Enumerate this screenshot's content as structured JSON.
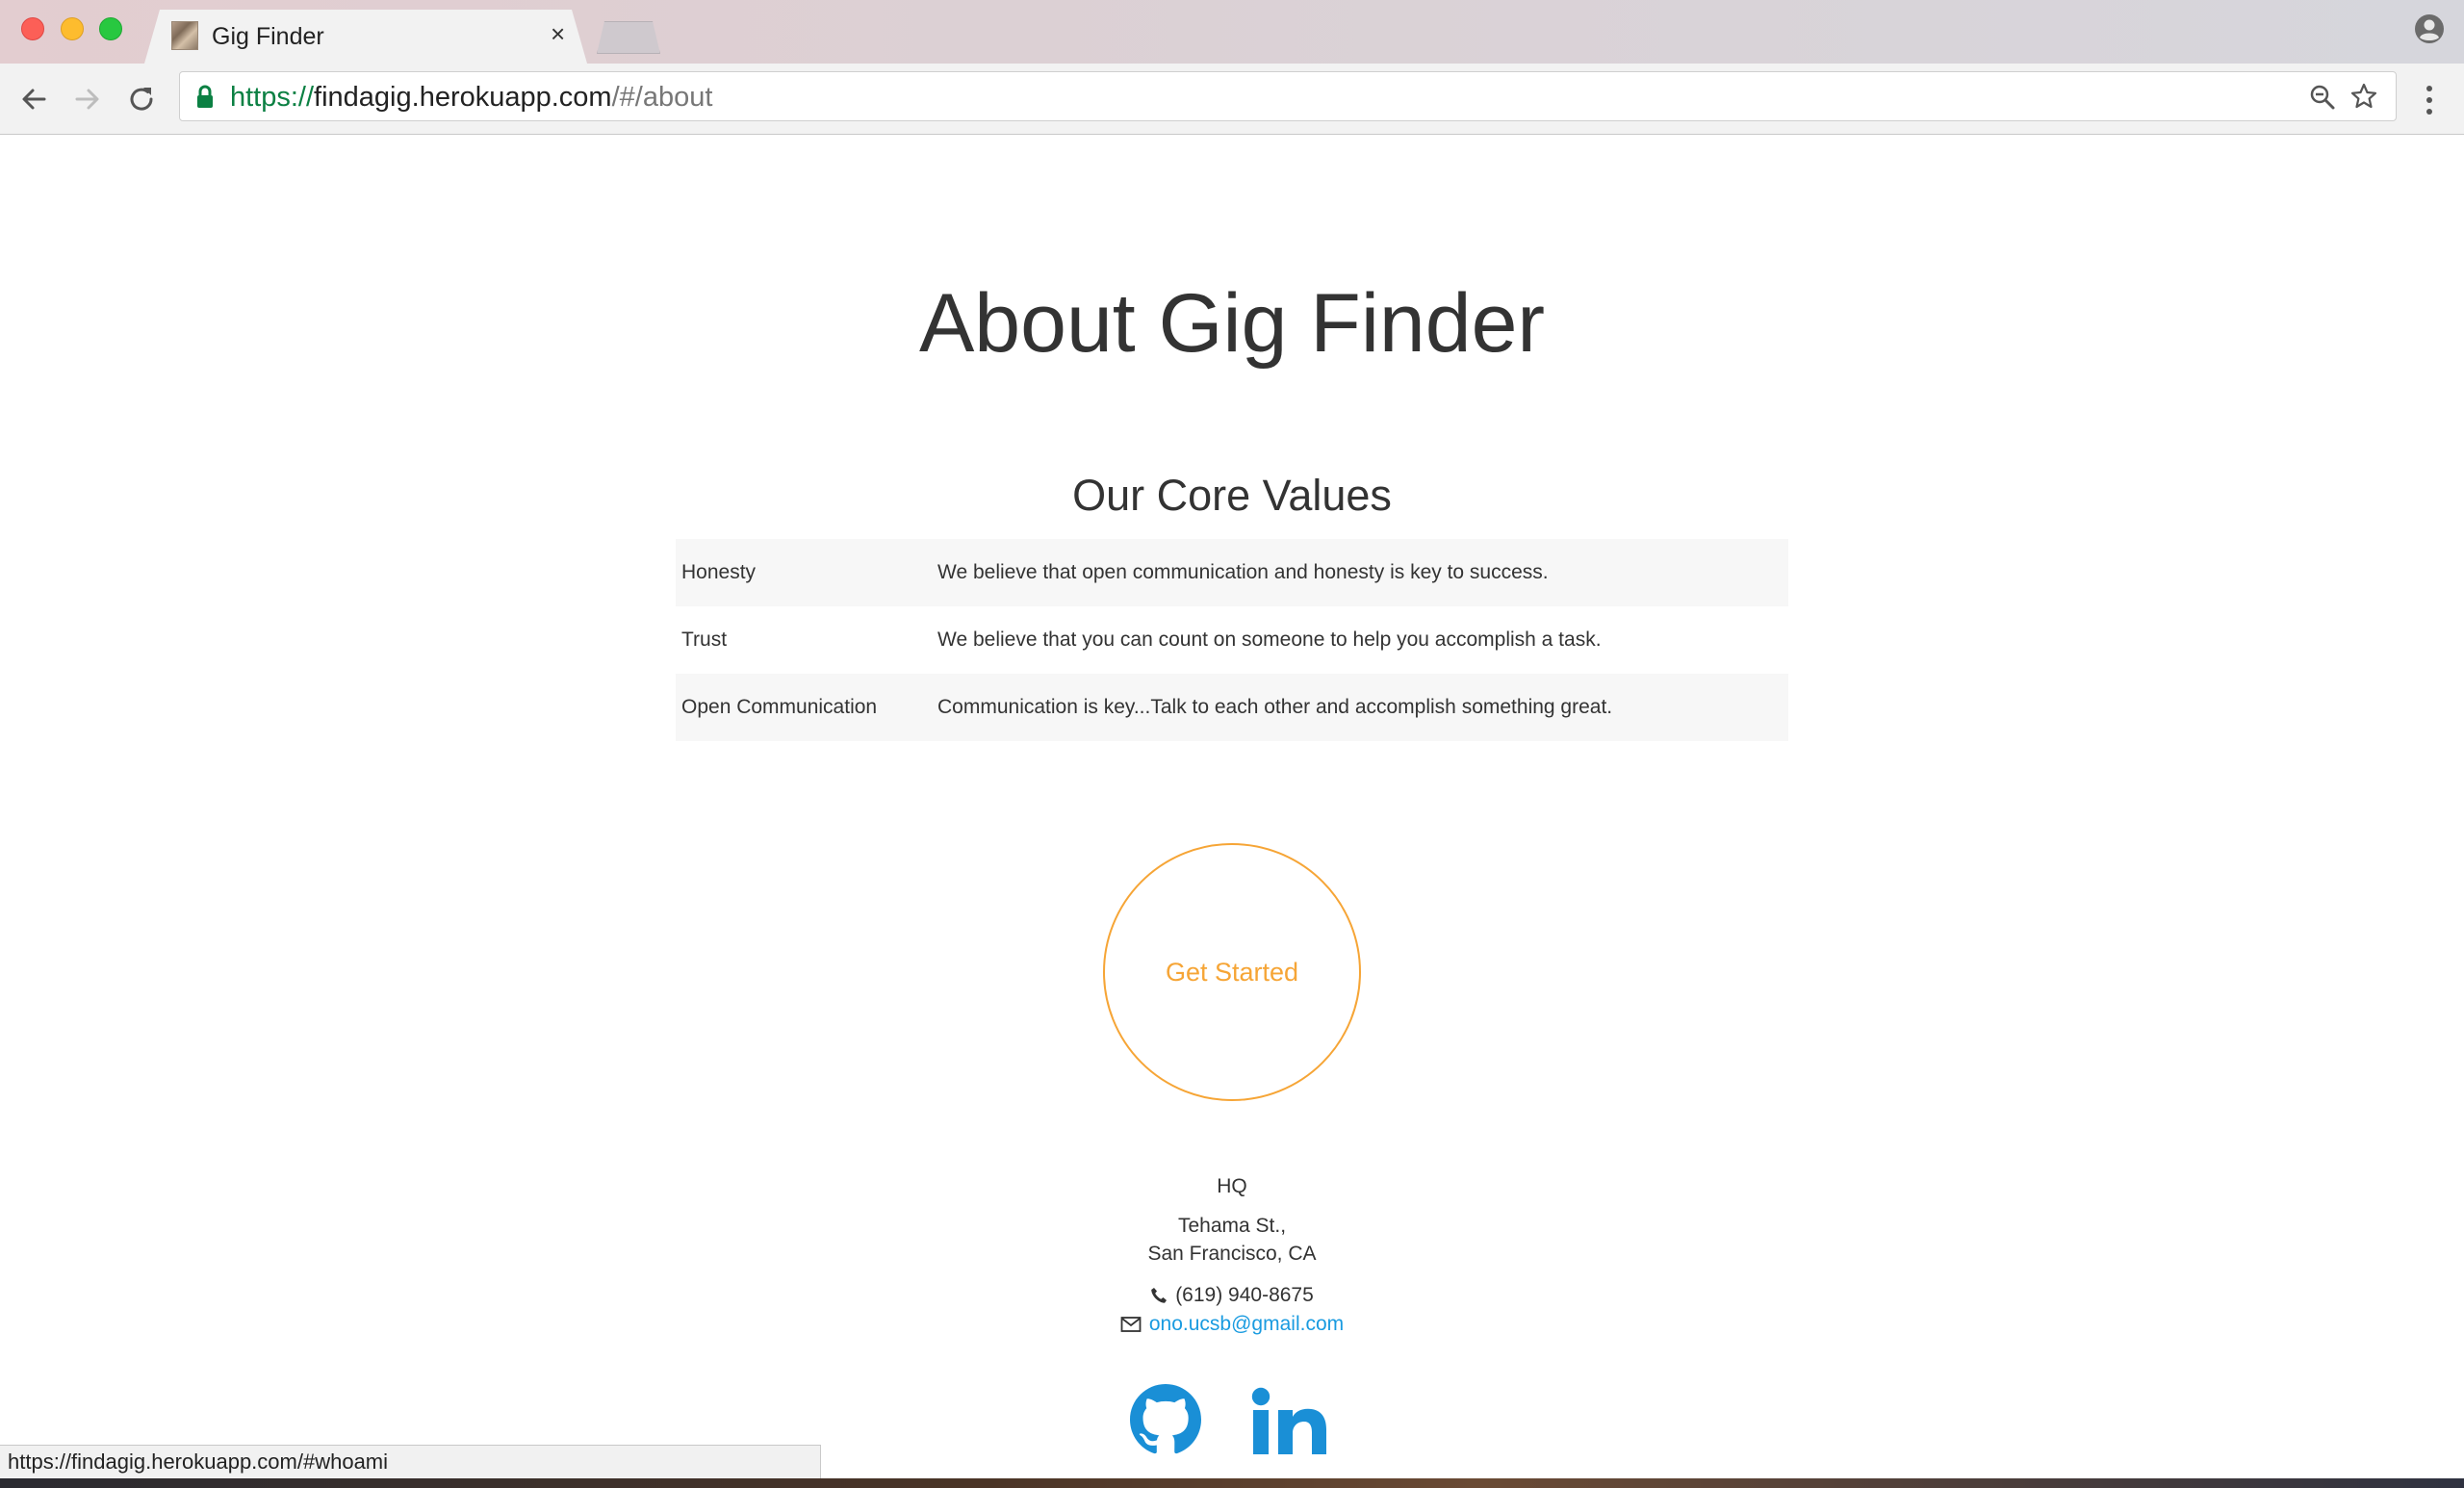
{
  "browser": {
    "tab_title": "Gig Finder",
    "tab_close": "×",
    "url_scheme": "https://",
    "url_host": "findagig.herokuapp.com",
    "url_path": "/#/about"
  },
  "page": {
    "title": "About Gig Finder",
    "section_title": "Our Core Values",
    "values": [
      {
        "name": "Honesty",
        "description": "We believe that open communication and honesty is key to success."
      },
      {
        "name": "Trust",
        "description": "We believe that you can count on someone to help you accomplish a task."
      },
      {
        "name": "Open Communication",
        "description": "Communication is key...Talk to each other and accomplish something great."
      }
    ],
    "cta_label": "Get Started"
  },
  "contact": {
    "hq_label": "HQ",
    "address_line1": "Tehama St.,",
    "address_line2": "San Francisco, CA",
    "phone": "(619) 940-8675",
    "email": "ono.ucsb@gmail.com"
  },
  "status_bar": {
    "hover_url": "https://findagig.herokuapp.com/#whoami"
  },
  "colors": {
    "accent_orange": "#f6a536",
    "link_blue": "#1a9be0",
    "secure_green": "#0b8043"
  },
  "icons": [
    "github-icon",
    "linkedin-icon",
    "phone-icon",
    "envelope-icon",
    "lock-icon",
    "star-icon",
    "zoom-icon"
  ]
}
